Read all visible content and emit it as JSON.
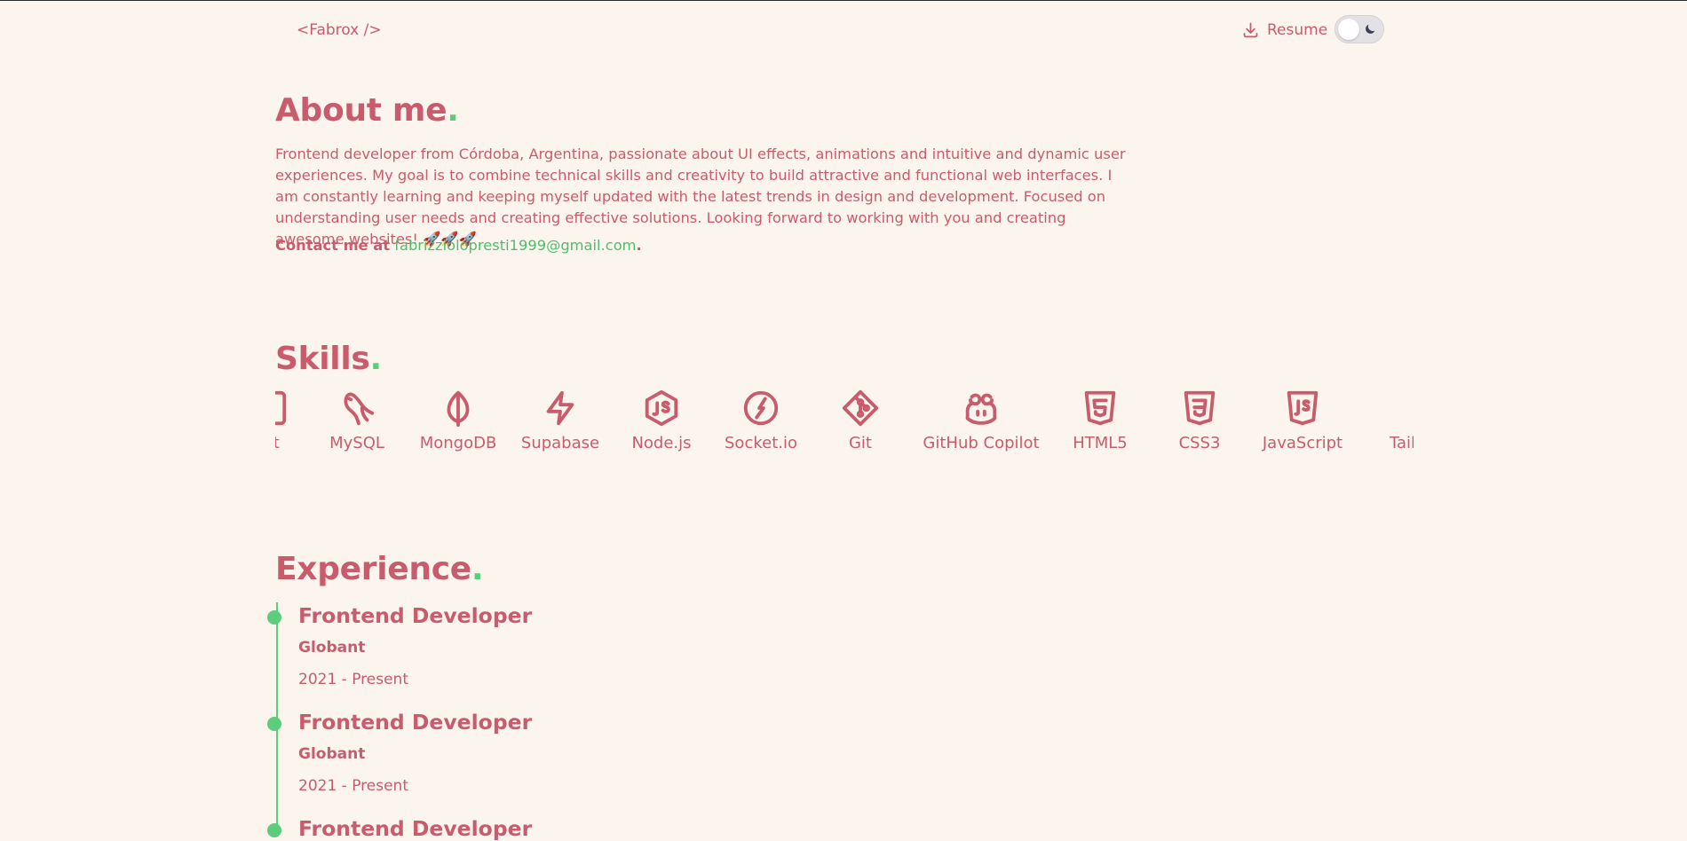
{
  "header": {
    "logo": "<Fabrox />",
    "resume_label": "Resume",
    "theme_toggle": {
      "state": "light"
    }
  },
  "about": {
    "title": "About me",
    "title_dot": ".",
    "text": "Frontend developer from Córdoba, Argentina, passionate about UI effects, animations and intuitive and dynamic user experiences. My goal is to combine technical skills and creativity to build attractive and functional web interfaces. I am constantly learning and keeping myself updated with the latest trends in design and development. Focused on understanding user needs and creating effective solutions. Looking forward to working with you and creating awesome websites! 🚀🚀🚀",
    "contact_label": "Contact me at",
    "email": "fabrizziolopresti1999@gmail.com",
    "contact_end": "."
  },
  "skills": {
    "title": "Skills",
    "title_dot": ".",
    "items": [
      {
        "label": "ipt",
        "icon": "typescript-icon"
      },
      {
        "label": "MySQL",
        "icon": "mysql-icon"
      },
      {
        "label": "MongoDB",
        "icon": "mongodb-icon"
      },
      {
        "label": "Supabase",
        "icon": "supabase-icon"
      },
      {
        "label": "Node.js",
        "icon": "nodejs-icon"
      },
      {
        "label": "Socket.io",
        "icon": "socketio-icon"
      },
      {
        "label": "Git",
        "icon": "git-icon"
      },
      {
        "label": "GitHub Copilot",
        "icon": "github-copilot-icon"
      },
      {
        "label": "HTML5",
        "icon": "html5-icon"
      },
      {
        "label": "CSS3",
        "icon": "css3-icon"
      },
      {
        "label": "JavaScript",
        "icon": "javascript-icon"
      },
      {
        "label": "Tailwi",
        "icon": "tailwind-icon"
      }
    ]
  },
  "experience": {
    "title": "Experience",
    "title_dot": ".",
    "items": [
      {
        "role": "Frontend Developer",
        "company": "Globant",
        "period": "2021 - Present"
      },
      {
        "role": "Frontend Developer",
        "company": "Globant",
        "period": "2021 - Present"
      },
      {
        "role": "Frontend Developer",
        "company": "",
        "period": ""
      }
    ]
  },
  "colors": {
    "background": "#fcf5ee",
    "primary": "#c85c6c",
    "accent": "#5ccd7c"
  }
}
